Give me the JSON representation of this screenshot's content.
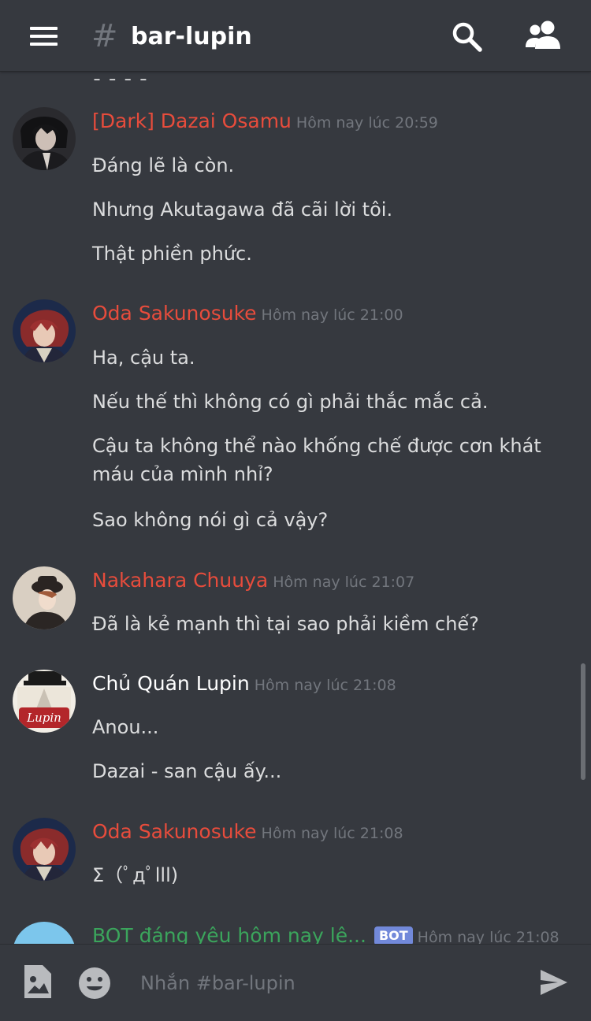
{
  "header": {
    "channel_hash": "#",
    "channel_name": "bar-lupin"
  },
  "colors": {
    "background": "#36393f",
    "author_red": "#e74c3c",
    "author_green": "#3ba55c",
    "bot_badge": "#7289da",
    "timestamp": "#72767d"
  },
  "icons": [
    "menu-icon",
    "search-icon",
    "members-icon",
    "image-upload-icon",
    "emoji-icon",
    "send-icon"
  ],
  "messages": [
    {
      "author": "[Dark] Dazai Osamu",
      "timestamp": "Hôm nay lúc 20:59",
      "lines": [
        "Đáng lẽ là còn.",
        "Nhưng Akutagawa đã cãi lời tôi.",
        "Thật phiền phức."
      ]
    },
    {
      "author": "Oda Sakunosuke",
      "timestamp": "Hôm nay lúc 21:00",
      "lines": [
        "Ha, cậu ta.",
        "Nếu thế thì không có gì phải thắc mắc cả.",
        "Cậu ta không thể nào khống chế được cơn khát máu của mình nhỉ?",
        "Sao không nói gì cả vậy?"
      ]
    },
    {
      "author": "Nakahara Chuuya",
      "timestamp": "Hôm nay lúc 21:07",
      "lines": [
        "Đã là kẻ mạnh thì tại sao phải kiềm chế?"
      ]
    },
    {
      "author": "Chủ Quán Lupin",
      "timestamp": "Hôm nay lúc 21:08",
      "lines": [
        "Anou...",
        "Dazai - san cậu ấy..."
      ]
    },
    {
      "author": "Oda Sakunosuke",
      "timestamp": "Hôm nay lúc 21:08",
      "lines": [
        "Σ（ﾟдﾟlll)"
      ]
    },
    {
      "author": "BOT đáng yêu hôm nay lê...",
      "badge": "BOT",
      "timestamp": "Hôm nay lúc 21:08"
    }
  ],
  "composer": {
    "placeholder": "Nhắn #bar-lupin"
  }
}
